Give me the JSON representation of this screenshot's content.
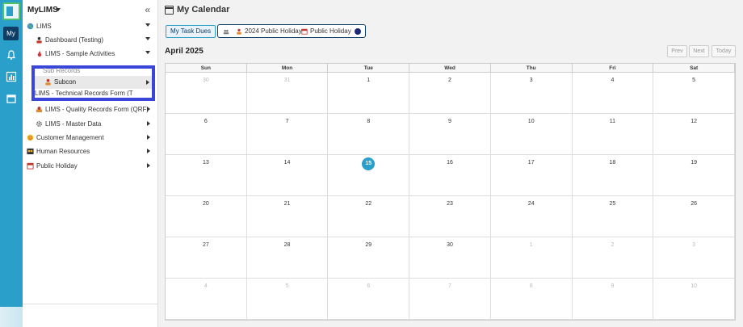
{
  "app": {
    "title": "MyLIMS",
    "rail_badge": "My"
  },
  "sidebar": {
    "items": [
      {
        "label": "LIMS",
        "icon": "globe-icon"
      },
      {
        "label": "Dashboard (Testing)",
        "icon": "person-icon"
      },
      {
        "label": "LIMS - Sample Activities",
        "icon": "flask-icon"
      },
      {
        "label": "LIMS - Quality Records Form (QRF)",
        "icon": "badge-icon"
      },
      {
        "label": "LIMS - Master Data",
        "icon": "gear-icon"
      },
      {
        "label": "Customer Management",
        "icon": "smiley-icon"
      },
      {
        "label": "Human Resources",
        "icon": "team-icon"
      },
      {
        "label": "Public Holiday",
        "icon": "calendar-icon"
      }
    ],
    "popup": {
      "partial_top": "Sub Records",
      "active": "Subcon",
      "partial_bottom": "LIMS - Technical Records Form (T"
    }
  },
  "main": {
    "title": "My Calendar",
    "task_button": "My Task Dues",
    "holiday_chip": {
      "label1": "2024 Public Holiday",
      "label2": "Public Holiday"
    },
    "month": "April 2025",
    "nav": {
      "prev": "Prev",
      "next": "Next",
      "today": "Today"
    },
    "weekdays": [
      "Sun",
      "Mon",
      "Tue",
      "Wed",
      "Thu",
      "Fri",
      "Sat"
    ],
    "weeks": [
      [
        "30",
        "31",
        "1",
        "2",
        "3",
        "4",
        "5"
      ],
      [
        "6",
        "7",
        "8",
        "9",
        "10",
        "11",
        "12"
      ],
      [
        "13",
        "14",
        "15",
        "16",
        "17",
        "18",
        "19"
      ],
      [
        "20",
        "21",
        "22",
        "23",
        "24",
        "25",
        "26"
      ],
      [
        "27",
        "28",
        "29",
        "30",
        "1",
        "2",
        "3"
      ],
      [
        "4",
        "5",
        "6",
        "7",
        "8",
        "9",
        "10"
      ]
    ],
    "today": "15",
    "colors": {
      "accent": "#2a9fc9",
      "navy": "#0e3d66",
      "highlight": "#3a46d9"
    }
  }
}
